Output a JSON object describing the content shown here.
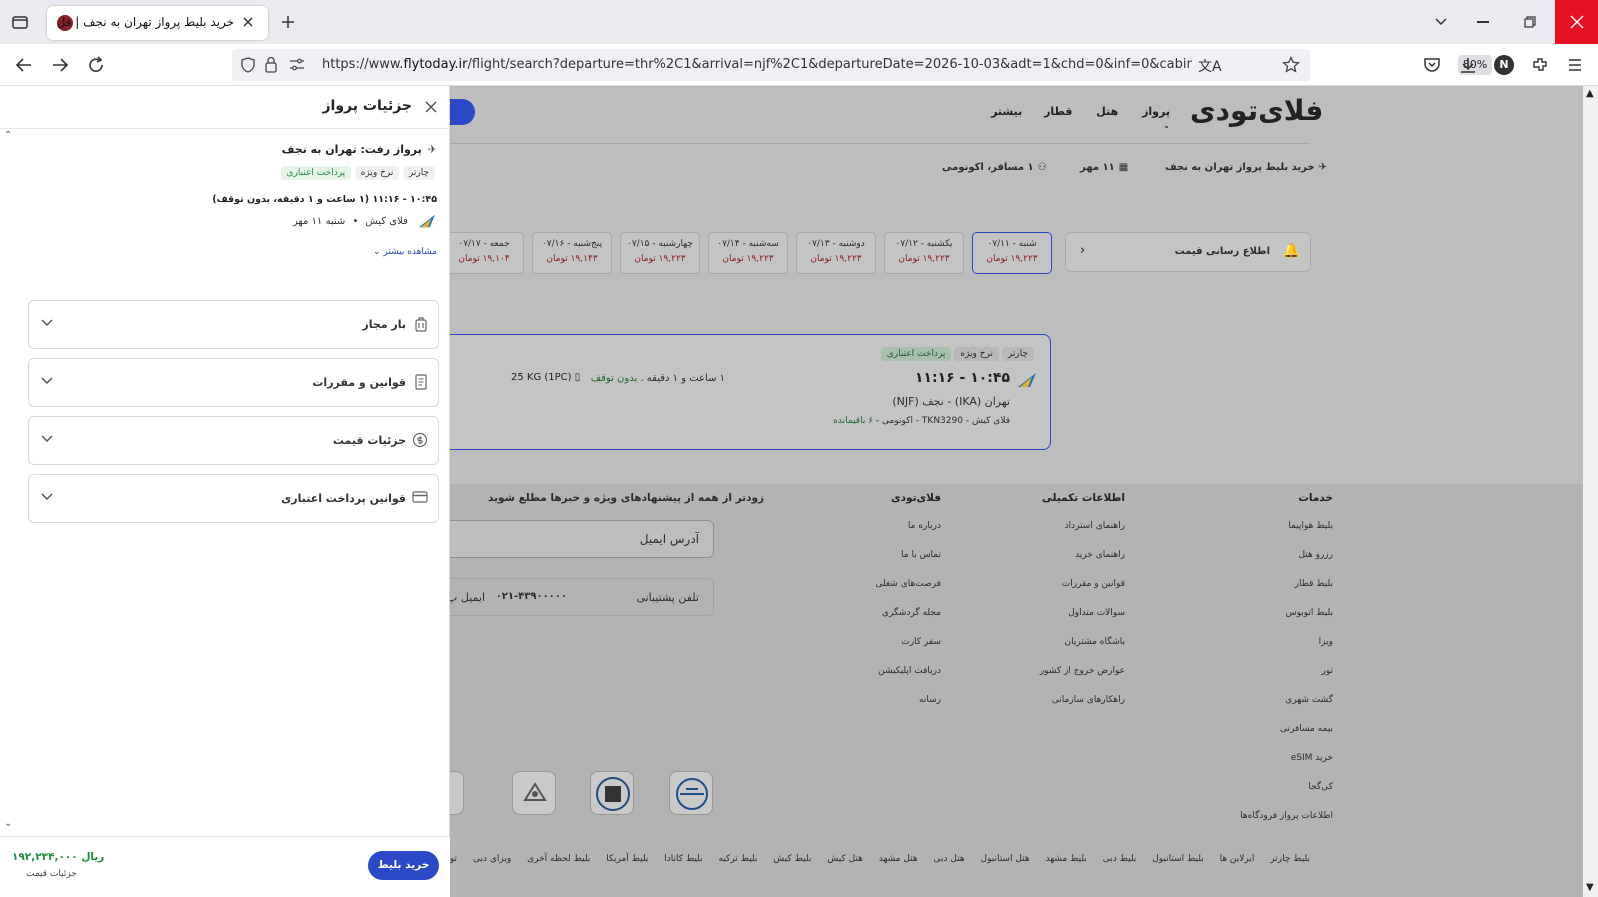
{
  "browser": {
    "tab_title": "خرید بلیط پرواز تهران به نجف | فل",
    "url_prefix": "https://www.",
    "url_host": "flytoday.ir",
    "url_rest": "/flight/search?departure=thr%2C1&arrival=njf%2C1&departureDate=2026-10-03&adt=1&chd=0&inf=0&cabin=1&tr",
    "zoom": "80%",
    "profile_initial": "N"
  },
  "site": {
    "logo": "فلای‌تودی",
    "nav": [
      "پرواز",
      "هتل",
      "قطار",
      "بیشتر"
    ],
    "search_summary": {
      "route": "خرید بلیط پرواز تهران به نجف",
      "date": "۱۱ مهر",
      "passengers": "۱ مسافر، اکونومی"
    },
    "price_alert": "اطلاع رسانی قیمت",
    "dates": [
      {
        "day": "شنبه - ۰۷/۱۱",
        "price": "۱۹,۲۲۳ تومان",
        "selected": true
      },
      {
        "day": "یکشنبه - ۰۷/۱۲",
        "price": "۱۹,۲۲۳ تومان"
      },
      {
        "day": "دوشنبه - ۰۷/۱۳",
        "price": "۱۹,۲۲۳ تومان"
      },
      {
        "day": "سه‌شنبه - ۰۷/۱۴",
        "price": "۱۹,۲۲۳ تومان"
      },
      {
        "day": "چهارشنبه - ۰۷/۱۵",
        "price": "۱۹,۲۲۳ تومان"
      },
      {
        "day": "پنج‌شنبه - ۰۷/۱۶",
        "price": "۱۹,۱۴۳ تومان"
      },
      {
        "day": "جمعه - ۰۷/۱۷",
        "price": "۱۹,۱۰۴ تومان"
      }
    ],
    "flight_card": {
      "tags": [
        "چارتر",
        "نرخ ویژه",
        "پرداخت اعتباری"
      ],
      "time": "۱۰:۴۵ - ۱۱:۱۶",
      "duration": "۱ ساعت و ۱ دقیقه .",
      "stops": "بدون توقف",
      "baggage": "25 KG (1PC)",
      "route": "تهران (IKA) - نجف (NJF)",
      "airline_info": "فلای کیش - TKN3290 - اکونومی -",
      "seats_left": "۶ باقیمانده"
    },
    "footer": {
      "services_title": "خدمات",
      "services": [
        "بلیط هواپیما",
        "رزرو هتل",
        "بلیط قطار",
        "بلیط اتوبوس",
        "ویزا",
        "تور",
        "گشت شهری",
        "بیمه مسافرتی",
        "خرید eSIM",
        "کی‌گجا",
        "اطلاعات پرواز فرودگاه‌ها"
      ],
      "info_title": "اطلاعات تکمیلی",
      "info": [
        "راهنمای استرداد",
        "راهنمای خرید",
        "قوانین و مقررات",
        "سوالات متداول",
        "باشگاه مشتریان",
        "عوارض خروج از کشور",
        "راهکارهای سازمانی"
      ],
      "company_title": "فلای‌تودی",
      "company": [
        "درباره ما",
        "تماس با ما",
        "فرصت‌های شغلی",
        "مجله گردشگری",
        "سفر کارت",
        "دریافت اپلیکیشن",
        "رسانه"
      ],
      "newsletter": "زودتر از همه از پیشنهادهای ویژه و خبرها مطلع شوید",
      "email_placeholder": "آدرس ایمیل",
      "support_label": "تلفن پشتیبانی",
      "support_phone": "۰۲۱-۴۳۹۰۰۰۰۰",
      "support_email_label": "ایمیل پ",
      "bottom_links": [
        "بلیط چارتر",
        "ایرلاین ها",
        "بلیط استانبول",
        "بلیط دبی",
        "بلیط مشهد",
        "هتل استانبول",
        "هتل دبی",
        "هتل مشهد",
        "هتل کیش",
        "بلیط کیش",
        "بلیط ترکیه",
        "بلیط کانادا",
        "بلیط آمریکا",
        "بلیط لحظه آخری",
        "ویزای دبی",
        "تور دبی"
      ]
    }
  },
  "panel": {
    "title": "جزئیات پرواز",
    "trip_title": "پرواز رفت: تهران به نجف",
    "tags": [
      "چارتر",
      "نرخ ویژه",
      "پرداخت اعتباری"
    ],
    "time_line": "۱۰:۴۵ - ۱۱:۱۶ (۱ ساعت و ۱ دقیقه، بدون توقف)",
    "airline": "فلای کیش",
    "date": "شنبه ۱۱ مهر",
    "more": "مشاهده بیشتر",
    "sections": [
      "بار مجاز",
      "قوانین و مقررات",
      "جزئیات قیمت",
      "قوانین پرداخت اعتباری"
    ],
    "total_price": "۱۹۲,۲۳۴,۰۰۰ ریال",
    "price_details": "جزئیات قیمت",
    "buy_button": "خرید بلیط",
    "colors": {
      "primary": "#2b48c7",
      "green": "#1e8a3e",
      "chip_green_bg": "#e6f4ea",
      "chip_gray_bg": "#f1f1f1"
    }
  }
}
